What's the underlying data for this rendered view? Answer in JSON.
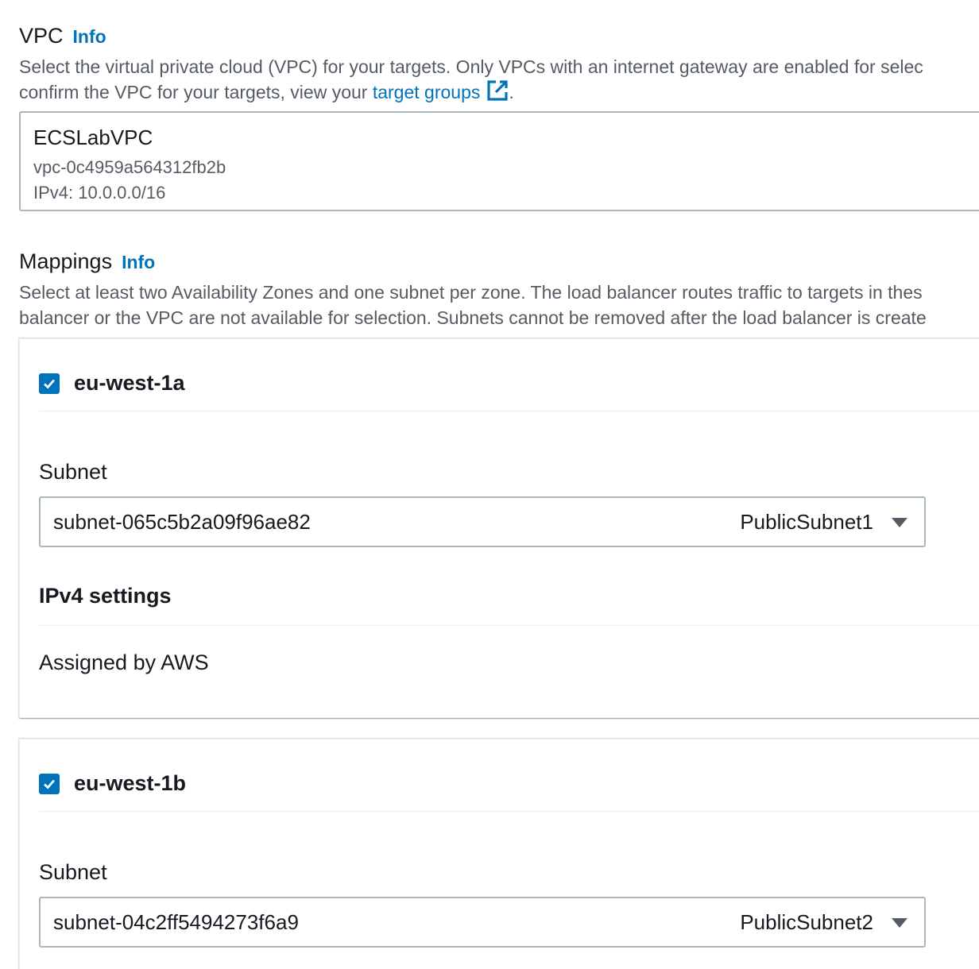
{
  "vpc": {
    "title": "VPC",
    "info_label": "Info",
    "description_line1": "Select the virtual private cloud (VPC) for your targets. Only VPCs with an internet gateway are enabled for selec",
    "description_line2_prefix": "confirm the VPC for your targets, view your ",
    "target_groups_link": "target groups",
    "description_line2_suffix": ".",
    "selected": {
      "name": "ECSLabVPC",
      "id": "vpc-0c4959a564312fb2b",
      "cidr": "IPv4: 10.0.0.0/16"
    }
  },
  "mappings": {
    "title": "Mappings",
    "info_label": "Info",
    "description_line1": "Select at least two Availability Zones and one subnet per zone. The load balancer routes traffic to targets in thes",
    "description_line2": "balancer or the VPC are not available for selection. Subnets cannot be removed after the load balancer is create",
    "zones": [
      {
        "name": "eu-west-1a",
        "checked": true,
        "subnet_label": "Subnet",
        "subnet_value": "subnet-065c5b2a09f96ae82",
        "subnet_tag": "PublicSubnet1",
        "ipv4_heading": "IPv4 settings",
        "ipv4_value": "Assigned by AWS"
      },
      {
        "name": "eu-west-1b",
        "checked": true,
        "subnet_label": "Subnet",
        "subnet_value": "subnet-04c2ff5494273f6a9",
        "subnet_tag": "PublicSubnet2"
      }
    ]
  },
  "colors": {
    "link": "#0073bb",
    "checkbox": "#0073bb",
    "border": "#aab7b8",
    "muted_text": "#545b64",
    "text": "#16191f"
  },
  "icons": {
    "external_link": "external-link-icon",
    "checkbox": "checkmark-icon",
    "dropdown": "caret-down-icon"
  }
}
